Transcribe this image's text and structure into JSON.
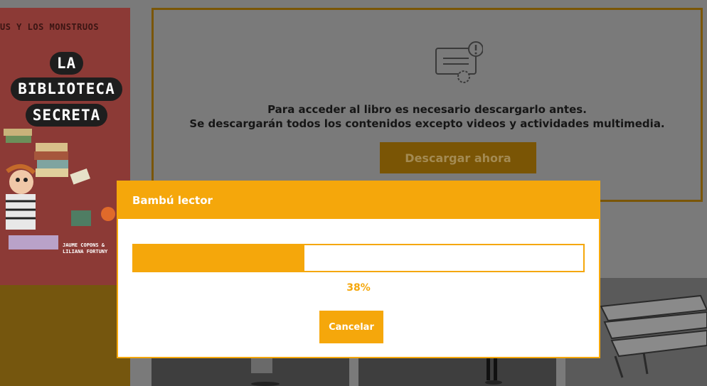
{
  "book": {
    "series": "US Y LOS MONSTRUOS",
    "title_lines": [
      "LA",
      "BIBLIOTECA",
      "SECRETA"
    ],
    "authors": [
      "JAUME COPONS &",
      "LILIANA FORTUNY"
    ]
  },
  "info_panel": {
    "icon": "certificate-alert-icon",
    "message_line1": "Para acceder al libro es necesario descargarlo antes.",
    "message_line2": "Se descargarán todos los contenidos excepto videos y actividades multimedia.",
    "download_label": "Descargar ahora"
  },
  "modal": {
    "title": "Bambú lector",
    "progress_percent": 38,
    "progress_label": "38%",
    "cancel_label": "Cancelar"
  },
  "colors": {
    "accent": "#f5a70b",
    "overlay_gray": "#7a7a7a",
    "download_button": "#7a5505",
    "panel_border": "#7a5608",
    "cover_red": "#8c3a36"
  }
}
